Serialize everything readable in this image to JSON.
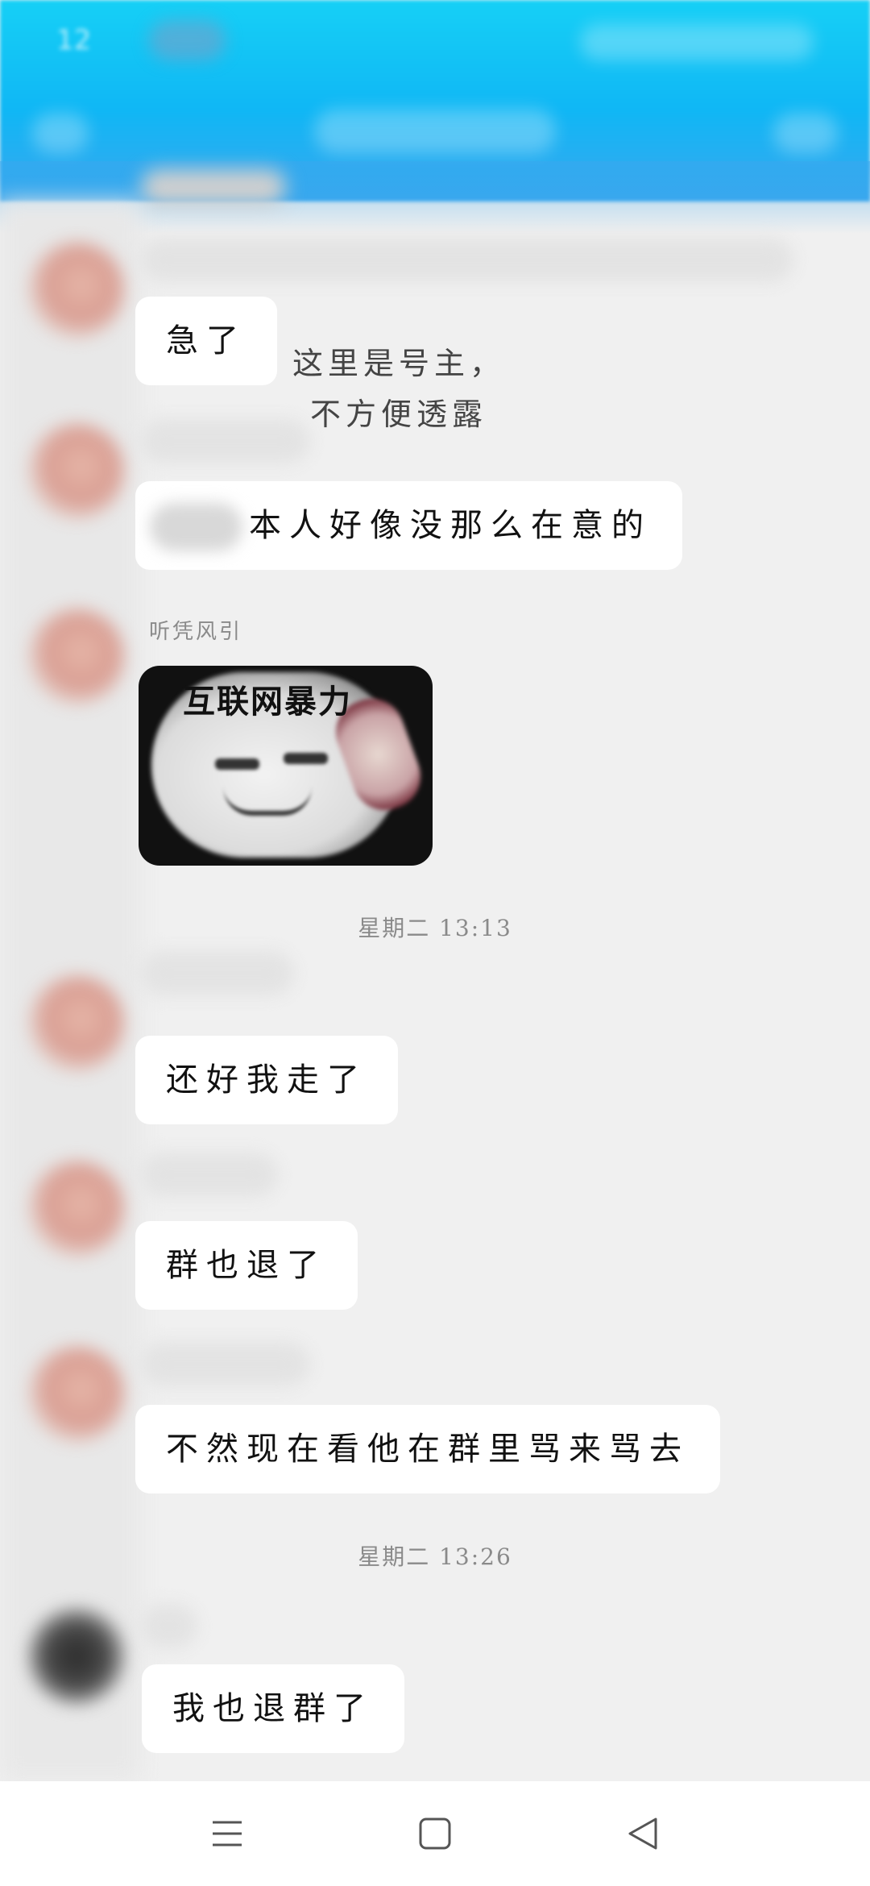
{
  "status_bar": {
    "time": "12"
  },
  "messages": {
    "m1": "急了",
    "m2": "本人好像没那么在意的",
    "sender3": "听凭风引",
    "sticker_caption": "互联网暴力",
    "m4": "还好我走了",
    "m5": "群也退了",
    "m6": "不然现在看他在群里骂来骂去",
    "m7": "我也退群了"
  },
  "timestamps": {
    "t1": "星期二 13:13",
    "t2": "星期二 13:26"
  },
  "overlay_note": {
    "line1": "这里是号主，",
    "line2": "不方便透露"
  },
  "nav": {
    "menu_icon": "menu-icon",
    "home_icon": "home-square-icon",
    "back_icon": "back-triangle-icon"
  },
  "colors": {
    "header_top": "#16d0f6",
    "header_bottom": "#3aa7ee",
    "background": "#f0f0f0",
    "bubble": "#ffffff"
  }
}
